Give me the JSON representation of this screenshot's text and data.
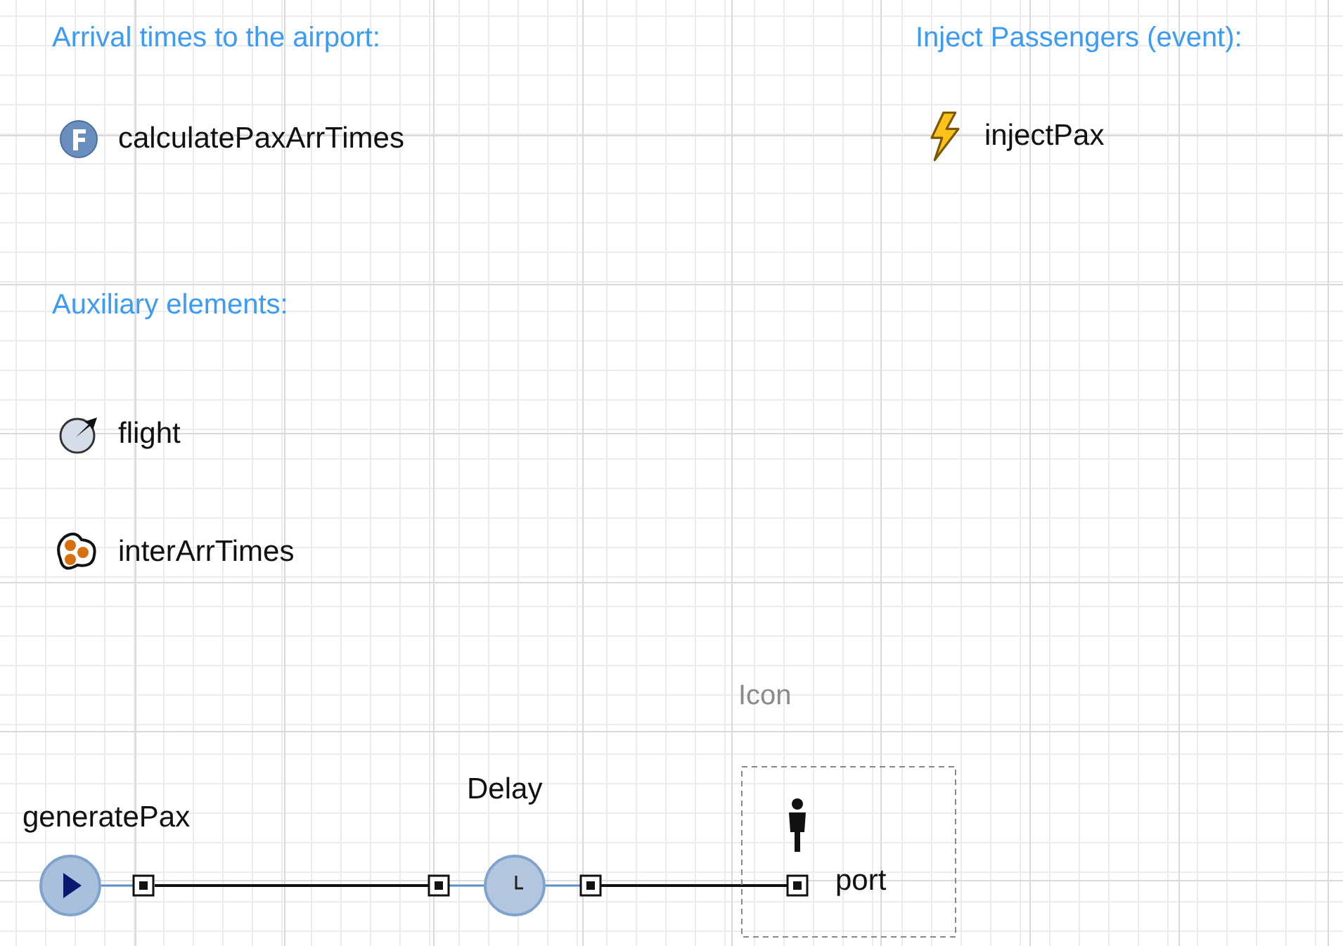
{
  "headings": [
    "Arrival times to the airport:",
    "Inject Passengers (event):",
    "Auxiliary elements:"
  ],
  "elements": [
    {
      "kind": "function",
      "name": "calculatePaxArrTimes"
    },
    {
      "kind": "event",
      "name": "injectPax"
    },
    {
      "kind": "variable",
      "name": "flight"
    },
    {
      "kind": "collection",
      "name": "interArrTimes"
    }
  ],
  "flowchart": {
    "blocks": [
      {
        "kind": "source",
        "name": "generatePax"
      },
      {
        "kind": "delay",
        "name": "Delay"
      }
    ],
    "icon_label": "Icon",
    "port_label": "port"
  }
}
